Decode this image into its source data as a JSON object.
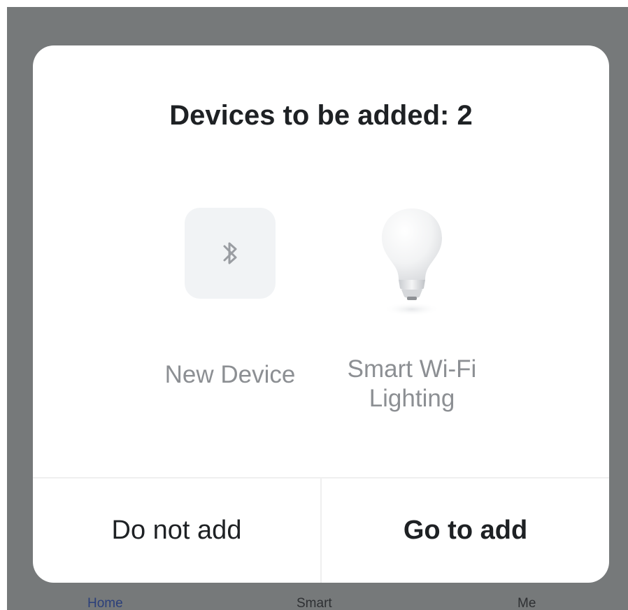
{
  "background_tabs": [
    {
      "label": "Home",
      "active": true
    },
    {
      "label": "Smart",
      "active": false
    },
    {
      "label": "Me",
      "active": false
    }
  ],
  "dialog": {
    "title": "Devices to be added: 2",
    "devices": [
      {
        "label": "New Device",
        "icon": "bluetooth-icon"
      },
      {
        "label": "Smart Wi-Fi Lighting",
        "icon": "light-bulb-icon"
      }
    ],
    "cancel_label": "Do not add",
    "confirm_label": "Go to add"
  },
  "colors": {
    "overlay": "#76797a",
    "dialog_bg": "#ffffff",
    "title_text": "#1e2124",
    "device_label": "#8c8f93",
    "tile_bg": "#f1f3f5",
    "active_tab": "#2b3f7a"
  }
}
